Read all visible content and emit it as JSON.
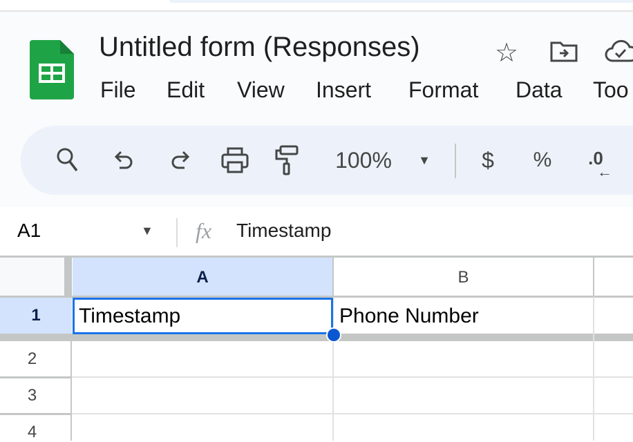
{
  "app": {
    "title": "Untitled form (Responses)",
    "brand_color": "#1ea446"
  },
  "menu": [
    "File",
    "Edit",
    "View",
    "Insert",
    "Format",
    "Data",
    "Too"
  ],
  "toolbar": {
    "zoom": "100%",
    "currency": "$",
    "percent": "%",
    "decrease_decimal": ".0"
  },
  "formula_bar": {
    "cell_ref": "A1",
    "fx": "fx",
    "value": "Timestamp"
  },
  "grid": {
    "columns": [
      "A",
      "B"
    ],
    "rows": [
      "1",
      "2",
      "3",
      "4"
    ],
    "cells": {
      "A1": "Timestamp",
      "B1": "Phone Number"
    },
    "selection_color": "#1a73e8"
  }
}
